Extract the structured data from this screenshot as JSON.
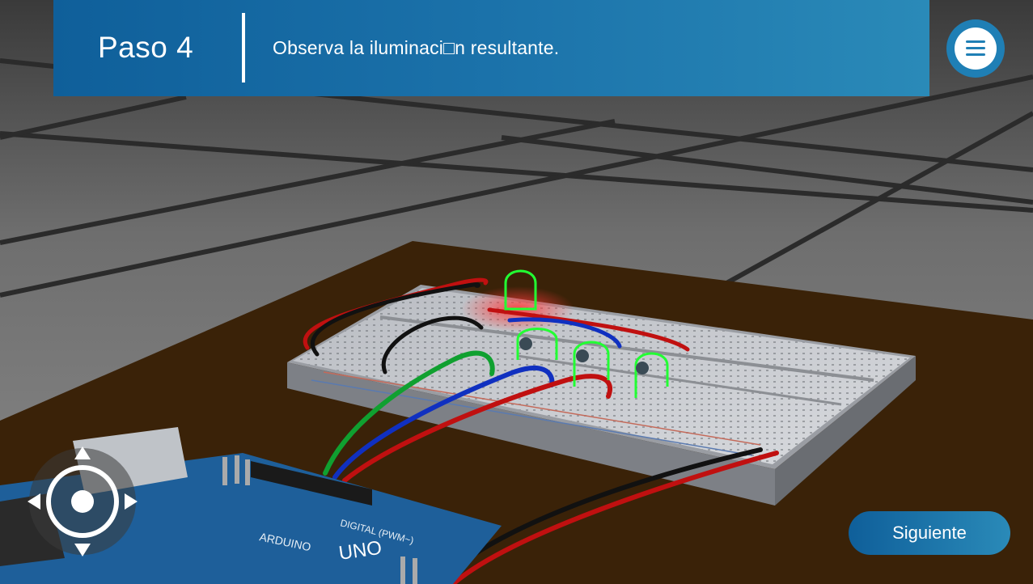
{
  "header": {
    "step_title": "Paso 4",
    "instruction": "Observa la iluminaci□n resultante."
  },
  "menu": {
    "icon": "hamburger-menu-icon"
  },
  "footer": {
    "next_label": "Siguiente"
  },
  "joystick": {
    "icon": "move-joystick-icon"
  },
  "scene": {
    "board_labels": [
      "UNO",
      "ARDUINO",
      "DIGITAL (PWM~)"
    ]
  },
  "colors": {
    "banner": "#1b72aa",
    "accent": "#2a8ab8",
    "led_highlight": "#22ff33",
    "table": "#3a2208"
  }
}
